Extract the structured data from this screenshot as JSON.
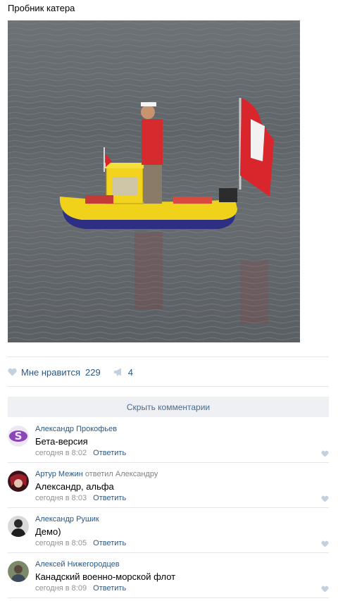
{
  "post": {
    "title": "Пробник катера"
  },
  "actions": {
    "like_label": "Мне нравится",
    "like_count": "229",
    "share_count": "4",
    "like_icon": "heart-icon",
    "share_icon": "megaphone-icon"
  },
  "hide_comments_label": "Скрыть комментарии",
  "comments": [
    {
      "author": "Александр Прокофьев",
      "reply_to": "",
      "text": "Бета-версия",
      "time": "сегодня в 8:02",
      "reply_label": "Ответить"
    },
    {
      "author": "Артур Межин",
      "reply_to": "ответил Александру",
      "text": "Александр, альфа",
      "time": "сегодня в 8:03",
      "reply_label": "Ответить"
    },
    {
      "author": "Александр Рушик",
      "reply_to": "",
      "text": "Демо)",
      "time": "сегодня в 8:05",
      "reply_label": "Ответить"
    },
    {
      "author": "Алексей Нижегородцев",
      "reply_to": "",
      "text": "Канадский военно-морской флот",
      "time": "сегодня в 8:09",
      "reply_label": "Ответить"
    }
  ],
  "colors": {
    "link": "#2a5885",
    "muted": "#939393",
    "divider": "#e4e6ea",
    "hide_bg": "#eef0f3"
  }
}
